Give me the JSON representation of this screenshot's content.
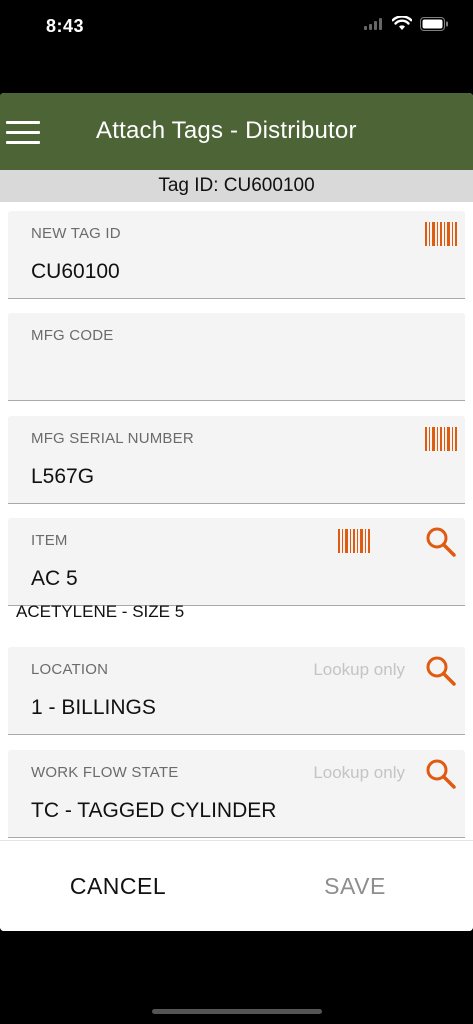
{
  "status_bar": {
    "time": "8:43"
  },
  "header": {
    "title": "Attach Tags - Distributor"
  },
  "tag_bar": {
    "text": "Tag ID: CU600100"
  },
  "fields": {
    "new_tag_id": {
      "label": "NEW TAG ID",
      "value": "CU60100"
    },
    "mfg_code": {
      "label": "MFG CODE",
      "value": ""
    },
    "mfg_serial": {
      "label": "MFG SERIAL NUMBER",
      "value": "L567G"
    },
    "item": {
      "label": "ITEM",
      "value": "AC  5",
      "description": "ACETYLENE - SIZE 5"
    },
    "location": {
      "label": "LOCATION",
      "value": "1 - BILLINGS",
      "hint": "Lookup only"
    },
    "workflow_state": {
      "label": "WORK FLOW STATE",
      "value": "TC - TAGGED CYLINDER",
      "hint": "Lookup only"
    }
  },
  "footer": {
    "cancel_label": "CANCEL",
    "save_label": "SAVE"
  },
  "colors": {
    "header_bg": "#4d6536",
    "accent": "#e05a10",
    "field_bg": "#f4f4f4"
  },
  "icons": {
    "menu": "hamburger-icon",
    "barcode": "barcode-icon",
    "search": "search-icon"
  }
}
